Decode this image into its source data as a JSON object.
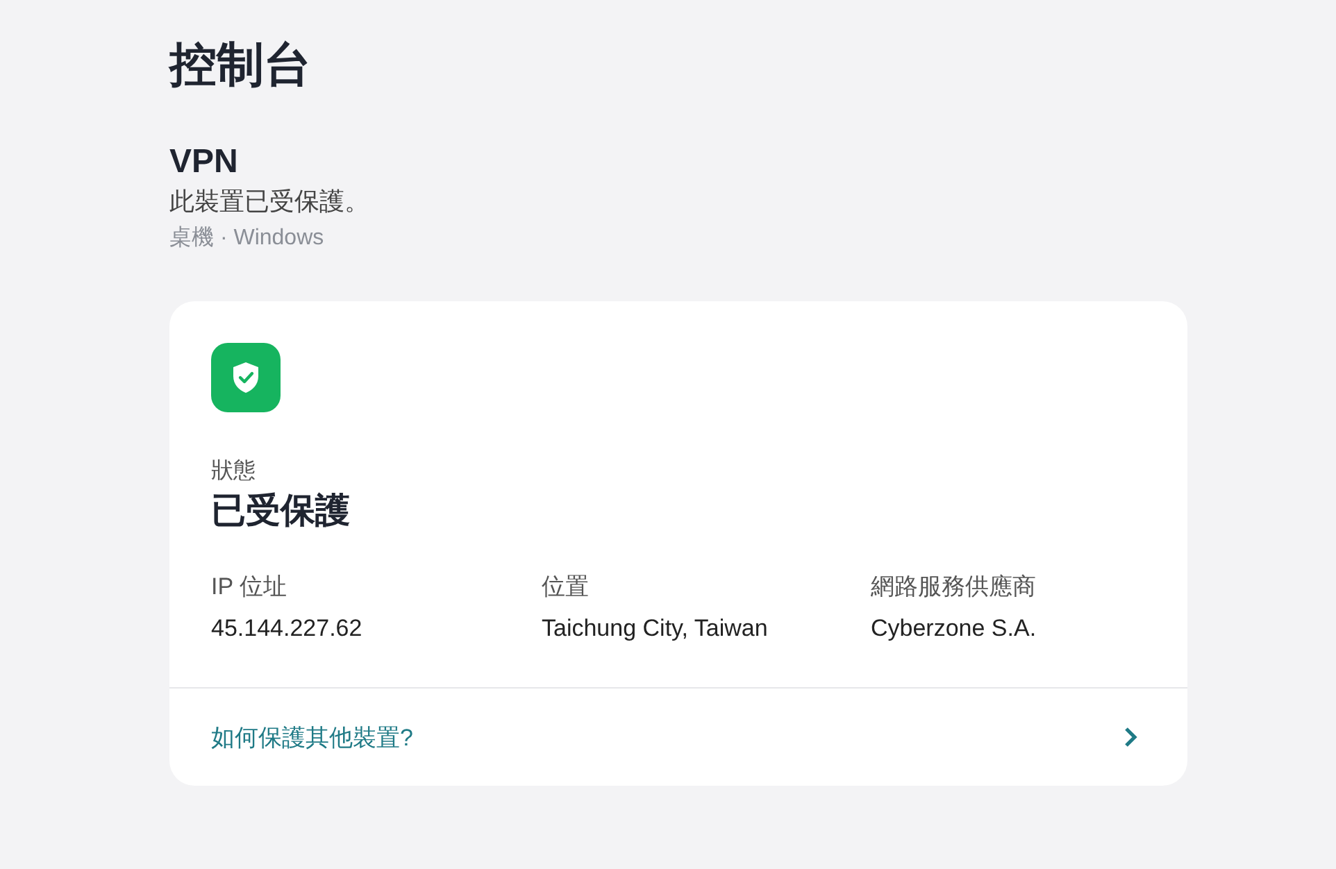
{
  "page_title": "控制台",
  "vpn": {
    "title": "VPN",
    "message": "此裝置已受保護。",
    "device": "桌機 · Windows"
  },
  "status": {
    "protected": true,
    "label": "狀態",
    "value": "已受保護"
  },
  "details": [
    {
      "label": "IP 位址",
      "value": "45.144.227.62"
    },
    {
      "label": "位置",
      "value": "Taichung City, Taiwan"
    },
    {
      "label": "網路服務供應商",
      "value": "Cyberzone S.A."
    }
  ],
  "help_link": "如何保護其他裝置?"
}
